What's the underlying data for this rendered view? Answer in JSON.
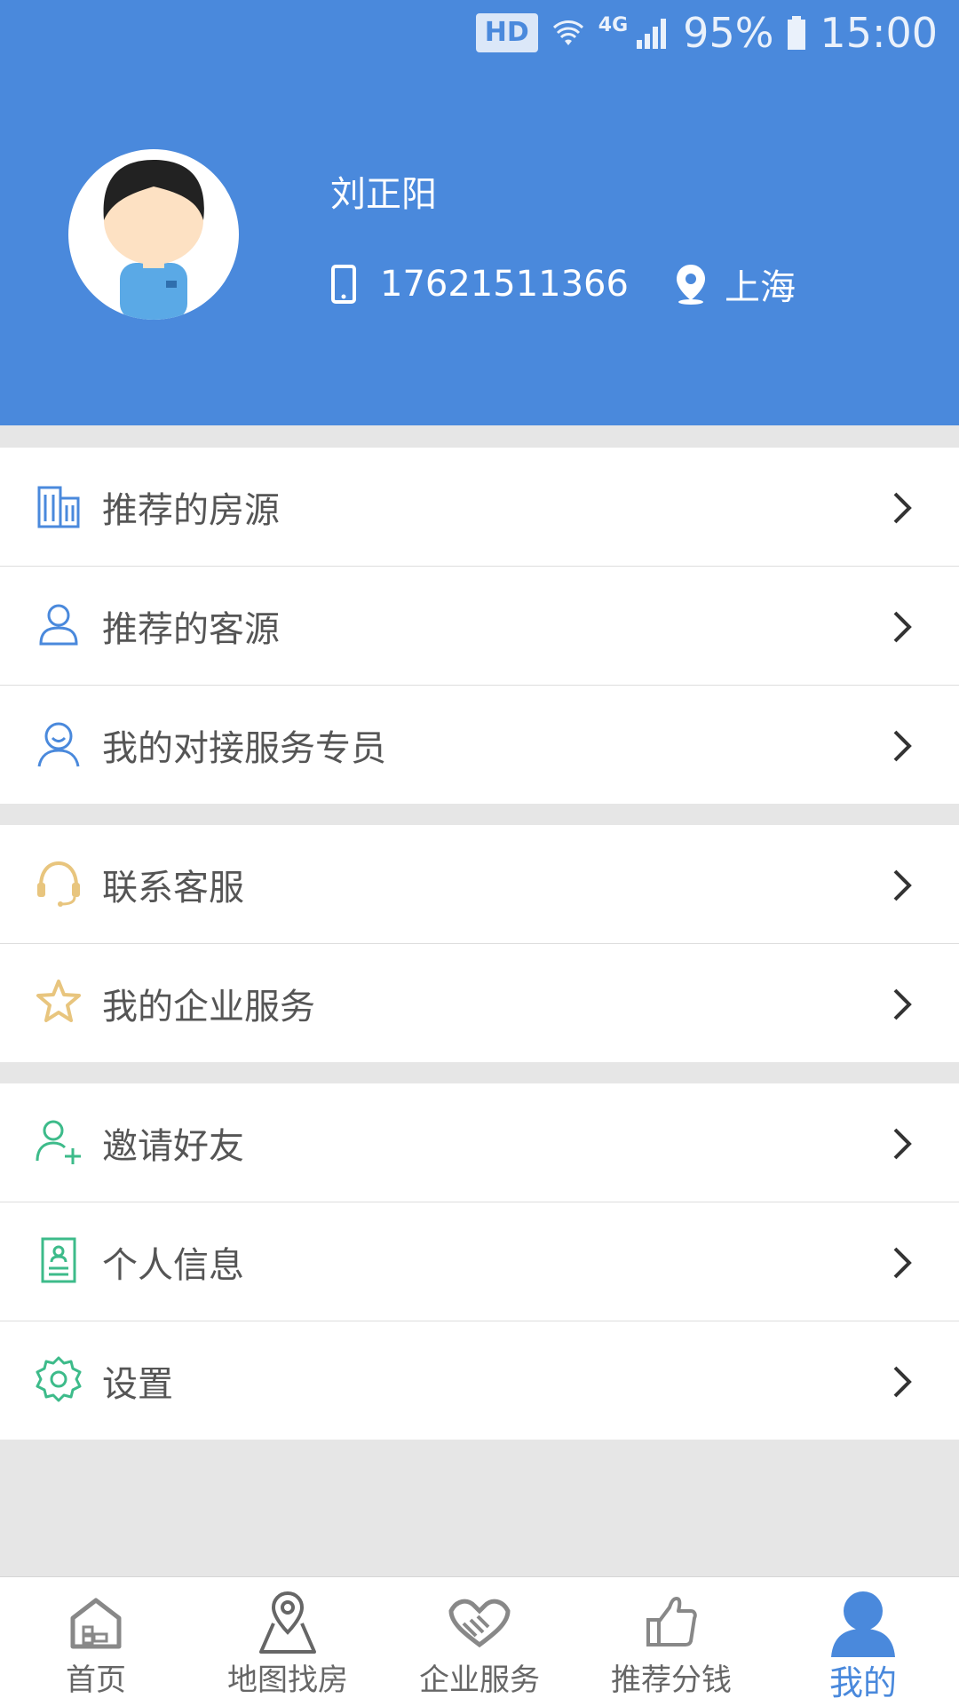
{
  "status_bar": {
    "hd": "HD",
    "network": "4G",
    "battery": "95%",
    "time": "15:00"
  },
  "profile": {
    "name": "刘正阳",
    "phone": "17621511366",
    "city": "上海"
  },
  "menu_groups": [
    {
      "items": [
        {
          "label": "推荐的房源",
          "icon": "building-icon",
          "color": "#4a89dc"
        },
        {
          "label": "推荐的客源",
          "icon": "person-icon",
          "color": "#4a89dc"
        },
        {
          "label": "我的对接服务专员",
          "icon": "smile-person-icon",
          "color": "#4a89dc"
        }
      ]
    },
    {
      "items": [
        {
          "label": "联系客服",
          "icon": "headset-icon",
          "color": "#e8c57e"
        },
        {
          "label": "我的企业服务",
          "icon": "star-icon",
          "color": "#e8c57e"
        }
      ]
    },
    {
      "items": [
        {
          "label": "邀请好友",
          "icon": "add-user-icon",
          "color": "#3dbb8a"
        },
        {
          "label": "个人信息",
          "icon": "id-card-icon",
          "color": "#3dbb8a"
        },
        {
          "label": "设置",
          "icon": "gear-icon",
          "color": "#3dbb8a"
        }
      ]
    }
  ],
  "tabbar": [
    {
      "label": "首页",
      "icon": "home-icon",
      "active": false
    },
    {
      "label": "地图找房",
      "icon": "map-pin-icon",
      "active": false
    },
    {
      "label": "企业服务",
      "icon": "handshake-icon",
      "active": false
    },
    {
      "label": "推荐分钱",
      "icon": "thumbs-up-icon",
      "active": false
    },
    {
      "label": "我的",
      "icon": "user-icon",
      "active": true
    }
  ],
  "colors": {
    "primary": "#4a89dc",
    "gold": "#e8c57e",
    "green": "#3dbb8a"
  }
}
